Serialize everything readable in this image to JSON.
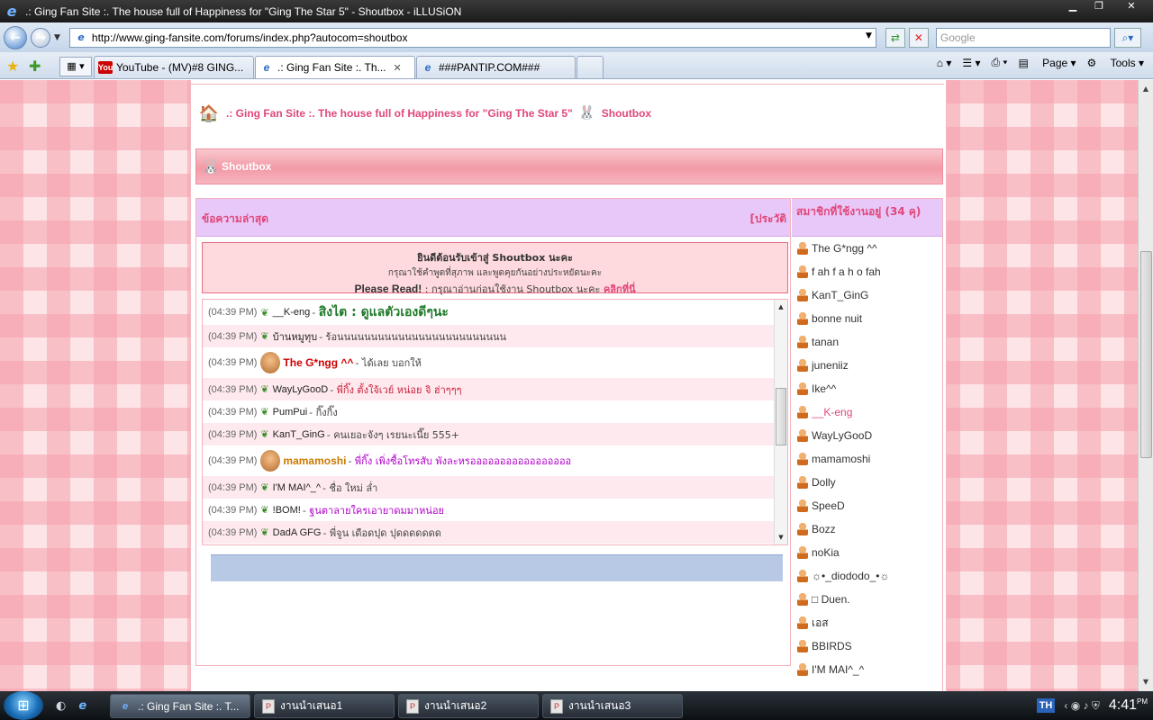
{
  "browser": {
    "window_title": ".: Ging Fan Site :. The house full of Happiness for \"Ging The Star 5\" - Shoutbox - iLLUSiON",
    "url": "http://www.ging-fansite.com/forums/index.php?autocom=shoutbox",
    "search_placeholder": "Google",
    "tabs": [
      {
        "title": "YouTube - (MV)#8 GING..."
      },
      {
        "title": ".: Ging Fan Site :. Th..."
      },
      {
        "title": "###PANTIP.COM###"
      }
    ],
    "commands": {
      "page": "Page",
      "tools": "Tools"
    }
  },
  "page": {
    "breadcrumb": {
      "site": ".: Ging Fan Site :. The house full of Happiness for \"Ging The Star 5\"",
      "section": "Shoutbox"
    },
    "shoutbox_title": "Shoutbox",
    "latest_header": "ข้อความล่าสุด",
    "history_link": "[ประวัติ",
    "welcome": {
      "title": "ยินดีต้อนรับเข้าสู่ Shoutbox นะคะ",
      "rule": "กรุณาใช้คำพูดที่สุภาพ และพูดคุยกันอย่างประหยัดนะคะ",
      "read_label": "Please Read!",
      "read_text": ": กรุณาอ่านก่อนใช้งาน Shoutbox นะคะ",
      "read_link": "คลิกที่นี่"
    },
    "messages": [
      {
        "time": "(04:39 PM)",
        "user": "__K-eng",
        "text": "สิงไต : ดูแลตัวเองดีๆนะ",
        "user_color": "#222222",
        "text_color": "#1f7a2a",
        "big": true,
        "avatar": false
      },
      {
        "time": "(04:39 PM)",
        "user": "บ้านหมูทุบ",
        "text": "ร้อนนนนนนนนนนนนนนนนนนนนนนนนน",
        "user_color": "#222222",
        "text_color": "#444444",
        "big": false,
        "avatar": false
      },
      {
        "time": "(04:39 PM)",
        "user": "The G*ngg ^^",
        "text": "ได้เลย บอกให้",
        "user_color": "#cc0000",
        "text_color": "#444444",
        "big": false,
        "avatar": true
      },
      {
        "time": "(04:39 PM)",
        "user": "WayLyGooD",
        "text": "พี่กิ๊ง ตั้งใจ้เวย์ หน่อย จิ ฮ่าๆๆๆ",
        "user_color": "#222222",
        "text_color": "#cc1f3d",
        "big": false,
        "avatar": false
      },
      {
        "time": "(04:39 PM)",
        "user": "PumPui",
        "text": "กิ๊งกิ๊ง",
        "user_color": "#222222",
        "text_color": "#444444",
        "big": false,
        "avatar": false
      },
      {
        "time": "(04:39 PM)",
        "user": "KanT_GinG",
        "text": "คนเยอะจังๆ เรยนะเนี๊ย 555+",
        "user_color": "#222222",
        "text_color": "#444444",
        "big": false,
        "avatar": false
      },
      {
        "time": "(04:39 PM)",
        "user": "mamamoshi",
        "text": "พี่กิ๊ง เพิ่งซื้อโทรสับ พังละหรอออออออออออออออออ",
        "user_color": "#cc7a00",
        "text_color": "#b000c8",
        "big": false,
        "avatar": true
      },
      {
        "time": "(04:39 PM)",
        "user": "I'M MAI^_^",
        "text": "ชื่อ ใหม่ ล่ำ",
        "user_color": "#222222",
        "text_color": "#444444",
        "big": false,
        "avatar": false
      },
      {
        "time": "(04:39 PM)",
        "user": "!BOM!",
        "text": "ฐนตาลายใครเอายาดมมาหน่อย",
        "user_color": "#222222",
        "text_color": "#b000c8",
        "big": false,
        "avatar": false
      },
      {
        "time": "(04:39 PM)",
        "user": "DadA GFG",
        "text": "พี่จูน เดือดปุด ปุดดดดดดด",
        "user_color": "#222222",
        "text_color": "#444444",
        "big": false,
        "avatar": false
      }
    ],
    "online_header": "สมาชิกที่ใช้งานอยู่ (34 คุ)",
    "members": [
      {
        "name": "The G*ngg ^^",
        "color": "#333333"
      },
      {
        "name": "f ah f a h o fah",
        "color": "#333333"
      },
      {
        "name": "KanT_GinG",
        "color": "#333333"
      },
      {
        "name": "bonne nuit",
        "color": "#333333"
      },
      {
        "name": "tanan",
        "color": "#333333"
      },
      {
        "name": "juneniiz",
        "color": "#333333"
      },
      {
        "name": "Ike^^",
        "color": "#333333"
      },
      {
        "name": "__K-eng",
        "color": "#e0477b"
      },
      {
        "name": "WayLyGooD",
        "color": "#333333"
      },
      {
        "name": "mamamoshi",
        "color": "#333333"
      },
      {
        "name": "Dolly",
        "color": "#333333"
      },
      {
        "name": "SpeeD",
        "color": "#333333"
      },
      {
        "name": "Bozz",
        "color": "#333333"
      },
      {
        "name": "noKia",
        "color": "#333333"
      },
      {
        "name": "☼•_diododo_•☼",
        "color": "#333333"
      },
      {
        "name": "□ Duen.",
        "color": "#333333"
      },
      {
        "name": "เอส",
        "color": "#333333"
      },
      {
        "name": "BBIRDS",
        "color": "#333333"
      },
      {
        "name": "I'M MAI^_^",
        "color": "#333333"
      }
    ]
  },
  "taskbar": {
    "tasks": [
      {
        "title": ".: Ging Fan Site :. T..."
      },
      {
        "title": "งานนำเสนอ1"
      },
      {
        "title": "งานนำเสนอ2"
      },
      {
        "title": "งานนำเสนอ3"
      }
    ],
    "lang": "TH",
    "clock": "4:41",
    "clock_suffix": "PM"
  },
  "colors": {
    "accent_pink": "#e0477b",
    "panel_lilac": "#e8c8f8"
  },
  "icons": [
    "ie-icon",
    "back-arrow-icon",
    "forward-arrow-icon",
    "refresh-icon",
    "stop-icon",
    "search-icon",
    "favorites-star-icon",
    "add-favorite-icon",
    "home-icon",
    "bunny-icon",
    "sprout-icon",
    "person-icon",
    "windows-start-icon"
  ]
}
